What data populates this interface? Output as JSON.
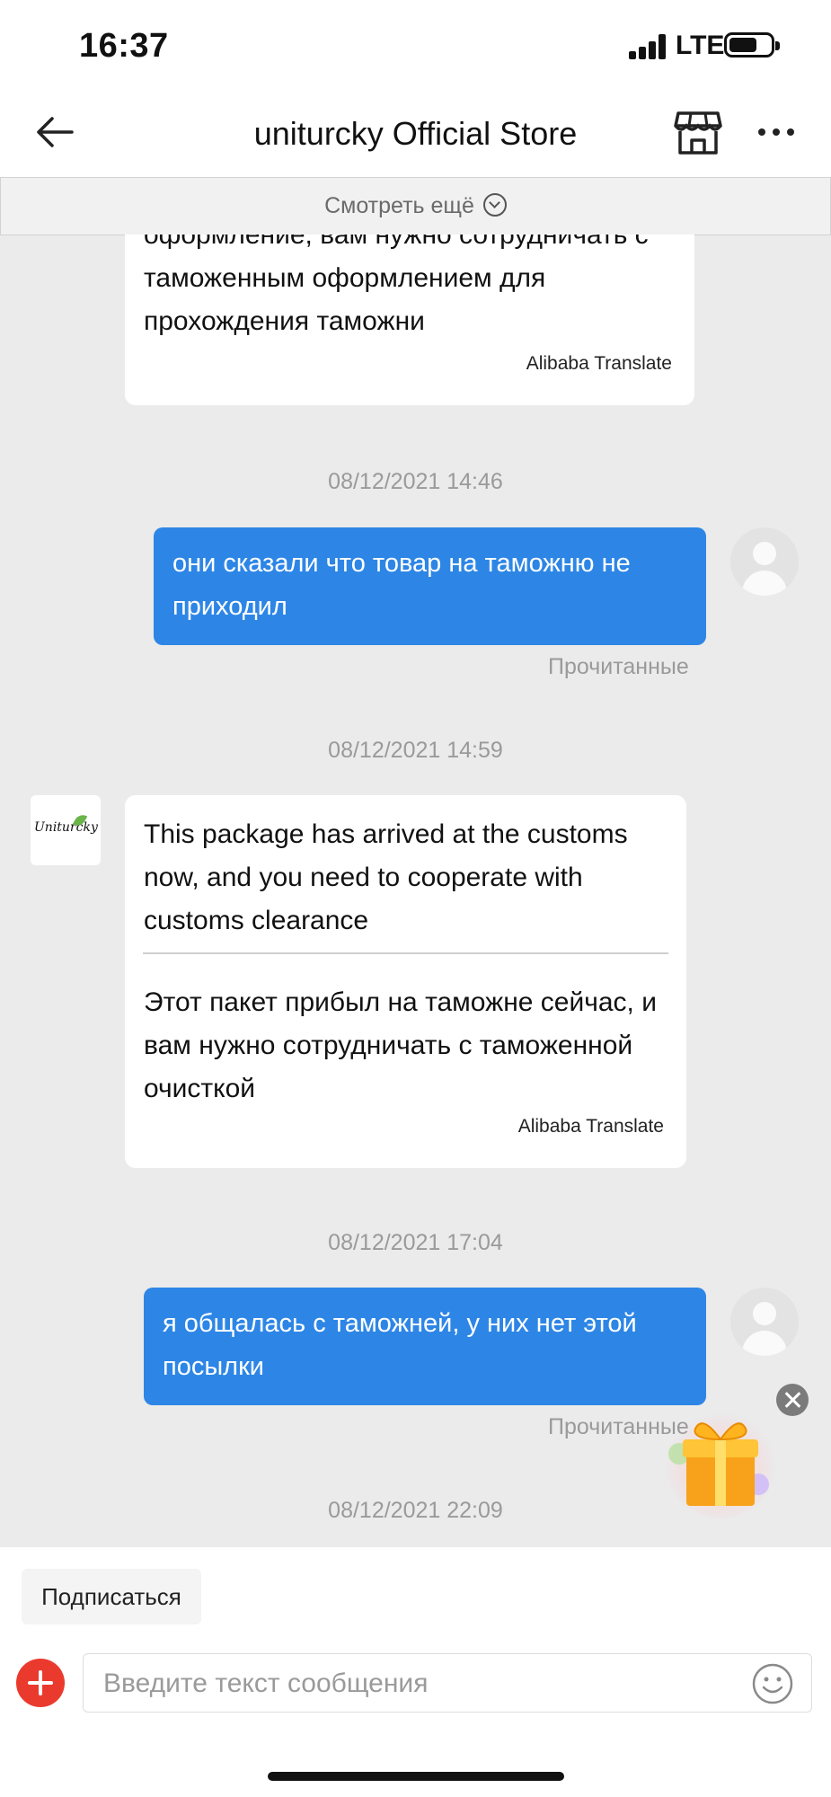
{
  "status_bar": {
    "time": "16:37",
    "network": "LTE"
  },
  "header": {
    "title": "uniturcky Official Store",
    "back_icon": "arrow-left-icon",
    "store_icon": "storefront-icon",
    "more_icon": "ellipsis-icon"
  },
  "see_more": {
    "label": "Смотреть ещё"
  },
  "messages": [
    {
      "sender": "store",
      "text": "оформление, вам нужно сотрудничать с таможенным оформлением для прохождения таможни",
      "translator": "Alibaba Translate"
    },
    {
      "timestamp": "08/12/2021 14:46"
    },
    {
      "sender": "user",
      "text": "они сказали что товар на таможню не приходил",
      "status": "Прочитанные"
    },
    {
      "timestamp": "08/12/2021 14:59"
    },
    {
      "sender": "store",
      "avatar_text": "Uniturcky",
      "original": "This package has arrived at the customs now, and you need to cooperate with customs clearance",
      "translation": "Этот пакет прибыл на таможне сейчас, и вам нужно сотрудничать с таможенной очисткой",
      "translator": "Alibaba Translate"
    },
    {
      "timestamp": "08/12/2021 17:04"
    },
    {
      "sender": "user",
      "text": "я общалась с таможней, у них нет этой посылки",
      "status": "Прочитанные"
    },
    {
      "timestamp": "08/12/2021 22:09"
    }
  ],
  "bottom": {
    "subscribe_label": "Подписаться",
    "input_placeholder": "Введите текст сообщения"
  },
  "colors": {
    "accent": "#2d86e6",
    "plus": "#ea3a2e",
    "background": "#ebebeb"
  }
}
